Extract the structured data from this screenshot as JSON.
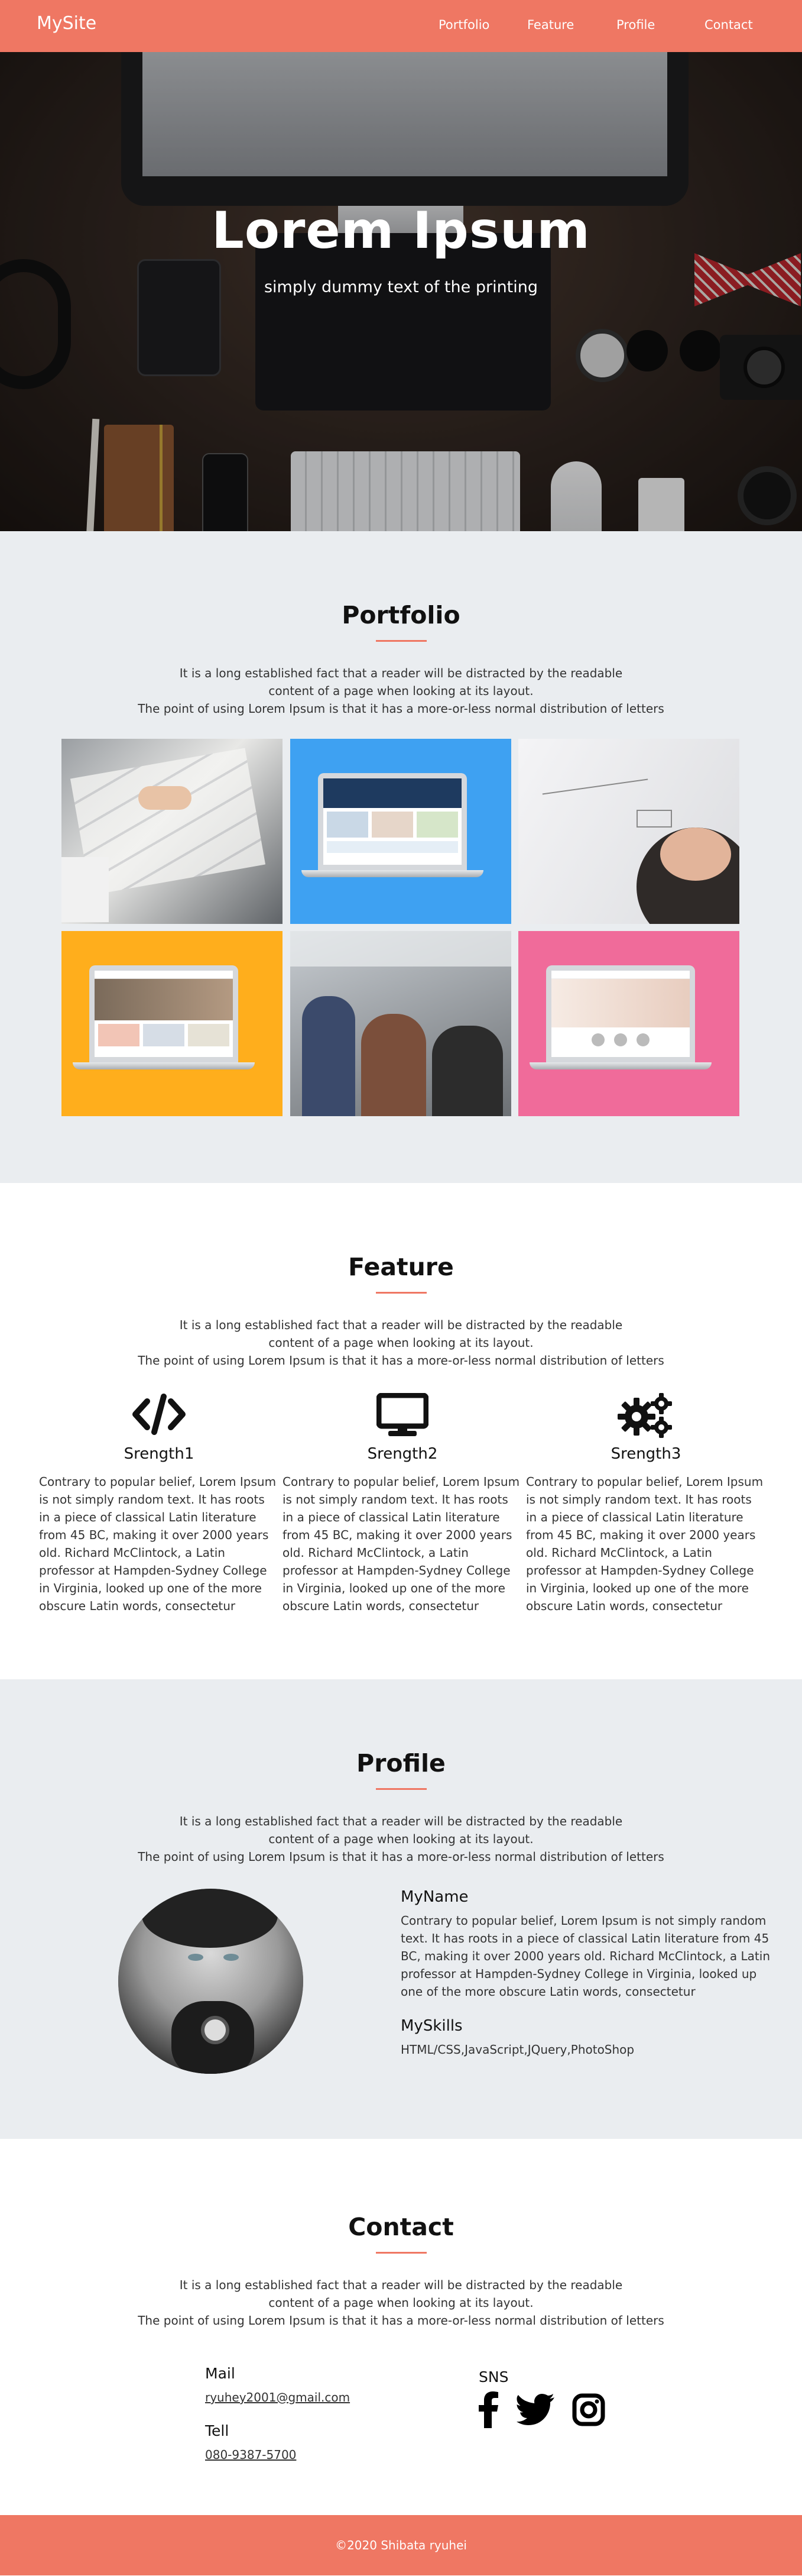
{
  "header": {
    "logo": "MySite",
    "nav": [
      "Portfolio",
      "Feature",
      "Profile",
      "Contact"
    ]
  },
  "hero": {
    "title": "Lorem Ipsum",
    "subtitle": "simply dummy text of the printing"
  },
  "intro_text": {
    "line1": "It is a long established fact that a reader will be distracted by the readable",
    "line2": "content of a page when looking at its layout.",
    "line3": "The point of using Lorem Ipsum is that it has a more-or-less normal distribution of letters"
  },
  "portfolio": {
    "title": "Portfolio",
    "tiles": [
      {
        "icon": "photo-hands-papers"
      },
      {
        "icon": "laptop-on-blue"
      },
      {
        "icon": "photo-whiteboard"
      },
      {
        "icon": "laptop-on-orange"
      },
      {
        "icon": "photo-team-meeting"
      },
      {
        "icon": "laptop-on-pink"
      }
    ]
  },
  "feature": {
    "title": "Feature",
    "items": [
      {
        "icon": "code-icon",
        "title": "Srength1",
        "text": "Contrary to popular belief, Lorem Ipsum is not simply random text. It has roots in a piece of classical Latin literature from 45 BC, making it over 2000 years old. Richard McClintock, a Latin professor at Hampden-Sydney College in Virginia, looked up one of the more obscure Latin words, consectetur"
      },
      {
        "icon": "desktop-icon",
        "title": "Srength2",
        "text": "Contrary to popular belief, Lorem Ipsum is not simply random text. It has roots in a piece of classical Latin literature from 45 BC, making it over 2000 years old. Richard McClintock, a Latin professor at Hampden-Sydney College in Virginia, looked up one of the more obscure Latin words, consectetur"
      },
      {
        "icon": "gears-icon",
        "title": "Srength3",
        "text": "Contrary to popular belief, Lorem Ipsum is not simply random text. It has roots in a piece of classical Latin literature from 45 BC, making it over 2000 years old. Richard McClintock, a Latin professor at Hampden-Sydney College in Virginia, looked up one of the more obscure Latin words, consectetur"
      }
    ]
  },
  "profile": {
    "title": "Profile",
    "name_heading": "MyName",
    "bio": "Contrary to popular belief, Lorem Ipsum is not simply random text. It has roots in a piece of classical Latin literature from 45 BC, making it over 2000 years old. Richard McClintock, a Latin professor at Hampden-Sydney College in Virginia, looked up one of the more obscure Latin words, consectetur",
    "skills_heading": "MySkills",
    "skills": "HTML/CSS,JavaScript,JQuery,PhotoShop"
  },
  "contact": {
    "title": "Contact",
    "mail_label": "Mail",
    "mail": "ryuhey2001@gmail.com",
    "tell_label": "Tell",
    "tell": "080-9387-5700",
    "sns_label": "SNS",
    "sns_icons": [
      "facebook-icon",
      "twitter-icon",
      "instagram-icon"
    ]
  },
  "footer": {
    "copyright": "©2020 Shibata ryuhei"
  },
  "colors": {
    "accent": "#ef7763",
    "section_grey": "#eaedf0",
    "tile_blue": "#3ea1f2",
    "tile_orange": "#ffae1c",
    "tile_pink": "#f06b9a"
  }
}
